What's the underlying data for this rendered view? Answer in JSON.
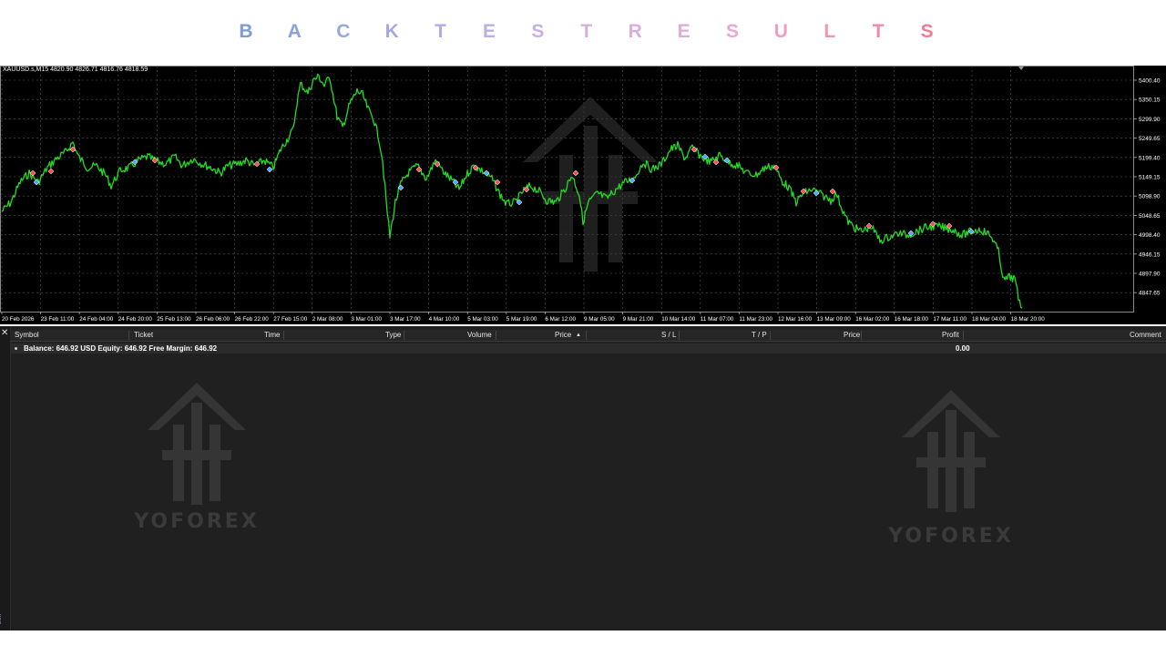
{
  "title": {
    "letters": [
      "B",
      "A",
      "C",
      "K",
      "T",
      "E",
      "S",
      "T",
      "R",
      "E",
      "S",
      "U",
      "L",
      "T",
      "S"
    ],
    "colors": [
      "#7f9bd6",
      "#8ca0dc",
      "#9aa6e0",
      "#a6a8e2",
      "#b3abe4",
      "#bcaee6",
      "#c6b0e6",
      "#d4b0e2",
      "#dcaede",
      "#e2acd8",
      "#e8a8d0",
      "#ec9fc4",
      "#ee96b6",
      "#f08aa6",
      "#f07c94"
    ]
  },
  "chart": {
    "symbol_info": "XAUUSD.s,M15  4820.90 4826.71 4816.76 4818.59",
    "price_labels": [
      "5400.40",
      "5350.15",
      "5299.90",
      "5249.65",
      "5199.40",
      "5149.15",
      "5098.90",
      "5048.65",
      "4998.40",
      "4946.15",
      "4897.90",
      "4847.65"
    ],
    "time_labels": [
      "20 Feb 2026",
      "23 Feb 11:00",
      "24 Feb 04:00",
      "24 Feb 20:00",
      "25 Feb 13:00",
      "26 Feb 06:00",
      "26 Feb 22:00",
      "27 Feb 15:00",
      "2 Mar 08:00",
      "3 Mar 01:00",
      "3 Mar 17:00",
      "4 Mar 10:00",
      "5 Mar 03:00",
      "5 Mar 19:00",
      "6 Mar 12:00",
      "9 Mar 05:00",
      "9 Mar 21:00",
      "10 Mar 14:00",
      "11 Mar 07:00",
      "11 Mar 23:00",
      "12 Mar 16:00",
      "13 Mar 09:00",
      "16 Mar 02:00",
      "16 Mar 18:00",
      "17 Mar 11:00",
      "18 Mar 04:00",
      "18 Mar 20:00"
    ],
    "line_color": "#22dd22",
    "background": "#000000",
    "grid_color": "#5a5a5a"
  },
  "terminal": {
    "close_glyph": "✕",
    "toolbox_label": "box",
    "columns": {
      "symbol": "Symbol",
      "ticket": "Ticket",
      "time": "Time",
      "type": "Type",
      "volume": "Volume",
      "price": "Price",
      "sort_glyph": "▲",
      "sl": "S / L",
      "tp": "T / P",
      "price2": "Price",
      "profit": "Profit",
      "comment": "Comment"
    },
    "balance_row": {
      "text": "Balance: 646.92 USD  Equity: 646.92  Free Margin: 646.92",
      "profit": "0.00"
    }
  },
  "watermarks": {
    "brand": "YOFOREX"
  }
}
